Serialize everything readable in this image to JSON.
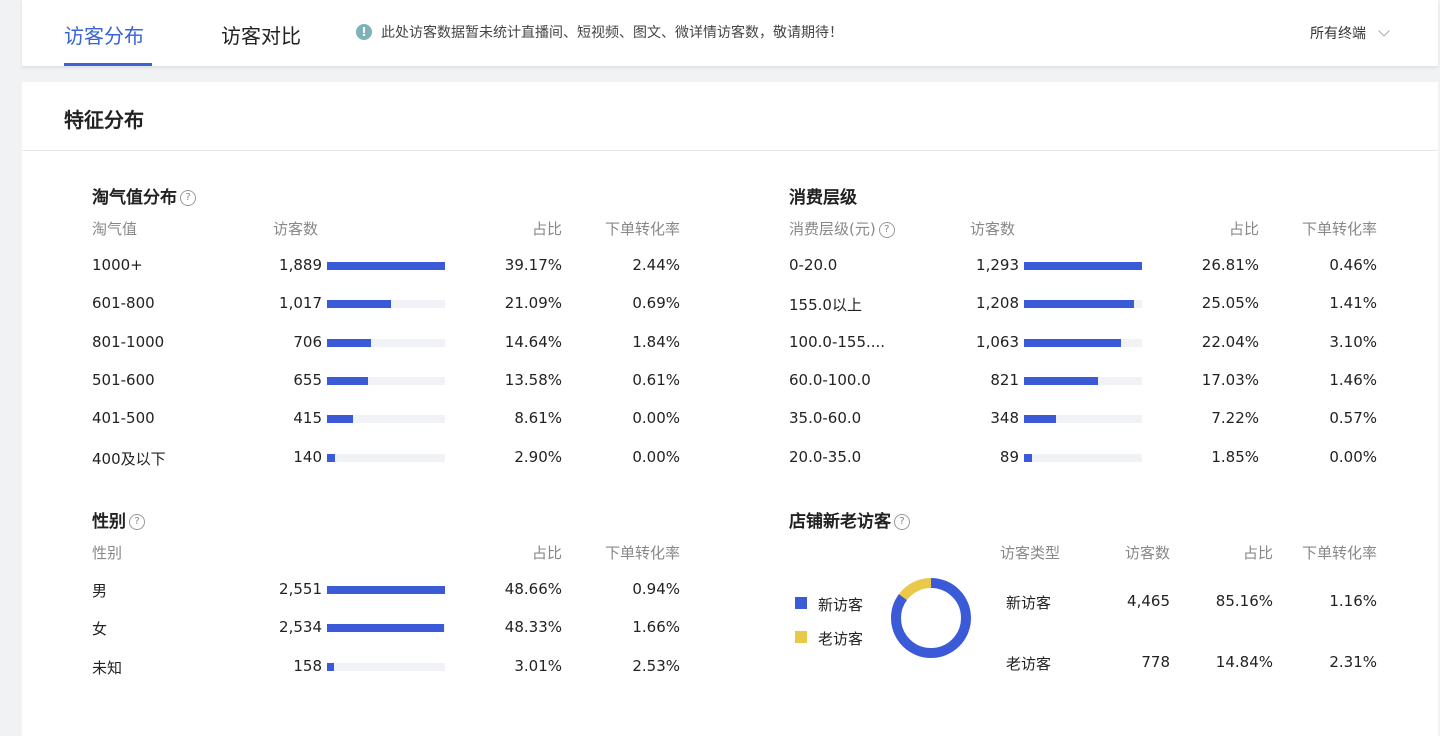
{
  "tabs": {
    "distribution": "访客分布",
    "compare": "访客对比"
  },
  "notice": "此处访客数据暂未统计直播间、短视频、图文、微详情访客数，敬请期待！",
  "terminal_select": "所有终端",
  "card_title": "特征分布",
  "taoqi": {
    "title": "淘气值分布",
    "headers": {
      "c1": "淘气值",
      "c2": "访客数",
      "c3": "占比",
      "c4": "下单转化率"
    },
    "rows": [
      {
        "label": "1000+",
        "count": "1,889",
        "ratio": "39.17%",
        "conv": "2.44%",
        "fill": 1.0
      },
      {
        "label": "601-800",
        "count": "1,017",
        "ratio": "21.09%",
        "conv": "0.69%",
        "fill": 0.54
      },
      {
        "label": "801-1000",
        "count": "706",
        "ratio": "14.64%",
        "conv": "1.84%",
        "fill": 0.37
      },
      {
        "label": "501-600",
        "count": "655",
        "ratio": "13.58%",
        "conv": "0.61%",
        "fill": 0.35
      },
      {
        "label": "401-500",
        "count": "415",
        "ratio": "8.61%",
        "conv": "0.00%",
        "fill": 0.22
      },
      {
        "label": "400及以下",
        "count": "140",
        "ratio": "2.90%",
        "conv": "0.00%",
        "fill": 0.07
      }
    ]
  },
  "consumption": {
    "title": "消费层级",
    "headers": {
      "c1": "消费层级(元)",
      "c2": "访客数",
      "c3": "占比",
      "c4": "下单转化率"
    },
    "rows": [
      {
        "label": "0-20.0",
        "count": "1,293",
        "ratio": "26.81%",
        "conv": "0.46%",
        "fill": 1.0
      },
      {
        "label": "155.0以上",
        "count": "1,208",
        "ratio": "25.05%",
        "conv": "1.41%",
        "fill": 0.93
      },
      {
        "label": "100.0-155....",
        "count": "1,063",
        "ratio": "22.04%",
        "conv": "3.10%",
        "fill": 0.82
      },
      {
        "label": "60.0-100.0",
        "count": "821",
        "ratio": "17.03%",
        "conv": "1.46%",
        "fill": 0.63
      },
      {
        "label": "35.0-60.0",
        "count": "348",
        "ratio": "7.22%",
        "conv": "0.57%",
        "fill": 0.27
      },
      {
        "label": "20.0-35.0",
        "count": "89",
        "ratio": "1.85%",
        "conv": "0.00%",
        "fill": 0.07
      }
    ]
  },
  "gender": {
    "title": "性别",
    "headers": {
      "c1": "性别",
      "c3": "占比",
      "c4": "下单转化率"
    },
    "rows": [
      {
        "label": "男",
        "count": "2,551",
        "ratio": "48.66%",
        "conv": "0.94%",
        "fill": 1.0
      },
      {
        "label": "女",
        "count": "2,534",
        "ratio": "48.33%",
        "conv": "1.66%",
        "fill": 0.99
      },
      {
        "label": "未知",
        "count": "158",
        "ratio": "3.01%",
        "conv": "2.53%",
        "fill": 0.06
      }
    ]
  },
  "visitors": {
    "title": "店铺新老访客",
    "headers": {
      "c1": "访客类型",
      "c2": "访客数",
      "c3": "占比",
      "c4": "下单转化率"
    },
    "legend": [
      {
        "label": "新访客",
        "color": "#3a5ad8"
      },
      {
        "label": "老访客",
        "color": "#e9c84a"
      }
    ],
    "rows": [
      {
        "label": "新访客",
        "count": "4,465",
        "ratio": "85.16%",
        "conv": "1.16%"
      },
      {
        "label": "老访客",
        "count": "778",
        "ratio": "14.84%",
        "conv": "2.31%"
      }
    ],
    "donut_fractions": [
      0.8516,
      0.1484
    ]
  }
}
